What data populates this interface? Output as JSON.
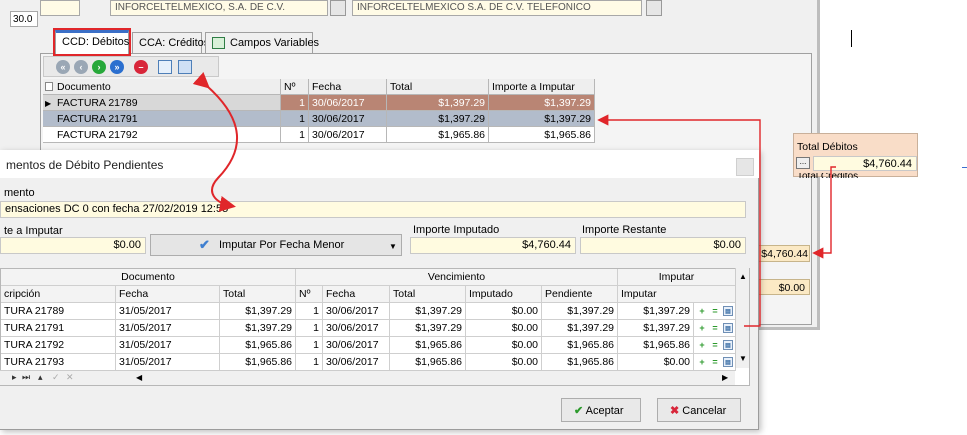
{
  "background": {
    "small_value": "30.0",
    "top_field_1": "INFORCELTELMEXICO, S.A. DE C.V.",
    "top_field_2": "INFORCELTELMEXICO S.A. DE C.V. TELEFONICO",
    "tabs": [
      {
        "label": "CCD: Débitos"
      },
      {
        "label": "CCA: Créditos"
      },
      {
        "label": "Campos Variables"
      }
    ],
    "grid": {
      "columns": [
        "Documento",
        "Nº",
        "Fecha",
        "Total",
        "Importe a Imputar"
      ],
      "rows": [
        {
          "doc": "FACTURA 21789",
          "n": "1",
          "fecha": "30/06/2017",
          "total": "$1,397.29",
          "imp": "$1,397.29"
        },
        {
          "doc": "FACTURA 21791",
          "n": "1",
          "fecha": "30/06/2017",
          "total": "$1,397.29",
          "imp": "$1,397.29"
        },
        {
          "doc": "FACTURA 21792",
          "n": "1",
          "fecha": "30/06/2017",
          "total": "$1,965.86",
          "imp": "$1,965.86"
        }
      ]
    },
    "totals": {
      "debitos_label": "Total Débitos",
      "debitos_value": "$4,760.44",
      "creditos_label": "Total Créditos",
      "big_value_1": "$4,760.44",
      "big_value_2": "$0.00",
      "button_label": "..."
    }
  },
  "dialog": {
    "title": "mentos de Débito Pendientes",
    "documento_label": "mento",
    "documento_value": "ensaciones DC 0 con fecha 27/02/2019 12:55",
    "importe_a_imputar_label": "te a Imputar",
    "importe_a_imputar_value": "$0.00",
    "imputar_button": "Imputar Por Fecha Menor",
    "importe_imputado_label": "Importe Imputado",
    "importe_imputado_value": "$4,760.44",
    "importe_restante_label": "Importe Restante",
    "importe_restante_value": "$0.00",
    "grid": {
      "groups": [
        "Documento",
        "Vencimiento",
        "Imputar"
      ],
      "columns": [
        "cripción",
        "Fecha",
        "Total",
        "Nº",
        "Fecha",
        "Total",
        "Imputado",
        "Pendiente",
        "Imputar"
      ],
      "rows": [
        {
          "desc": "TURA 21789",
          "fecha": "31/05/2017",
          "total": "$1,397.29",
          "n": "1",
          "vfecha": "30/06/2017",
          "vtotal": "$1,397.29",
          "imputado": "$0.00",
          "pendiente": "$1,397.29",
          "imputar": "$1,397.29"
        },
        {
          "desc": "TURA 21791",
          "fecha": "31/05/2017",
          "total": "$1,397.29",
          "n": "1",
          "vfecha": "30/06/2017",
          "vtotal": "$1,397.29",
          "imputado": "$0.00",
          "pendiente": "$1,397.29",
          "imputar": "$1,397.29"
        },
        {
          "desc": "TURA 21792",
          "fecha": "31/05/2017",
          "total": "$1,965.86",
          "n": "1",
          "vfecha": "30/06/2017",
          "vtotal": "$1,965.86",
          "imputado": "$0.00",
          "pendiente": "$1,965.86",
          "imputar": "$1,965.86"
        },
        {
          "desc": "TURA 21793",
          "fecha": "31/05/2017",
          "total": "$1,965.86",
          "n": "1",
          "vfecha": "30/06/2017",
          "vtotal": "$1,965.86",
          "imputado": "$0.00",
          "pendiente": "$1,965.86",
          "imputar": "$0.00"
        }
      ]
    },
    "accept_button": "Aceptar",
    "cancel_button": "Cancelar"
  },
  "colors": {
    "annotation_red": "#e0262a",
    "selected_row": "#b98574",
    "highlight_row": "#b2bccb",
    "field_yellow": "#fffbe0"
  }
}
